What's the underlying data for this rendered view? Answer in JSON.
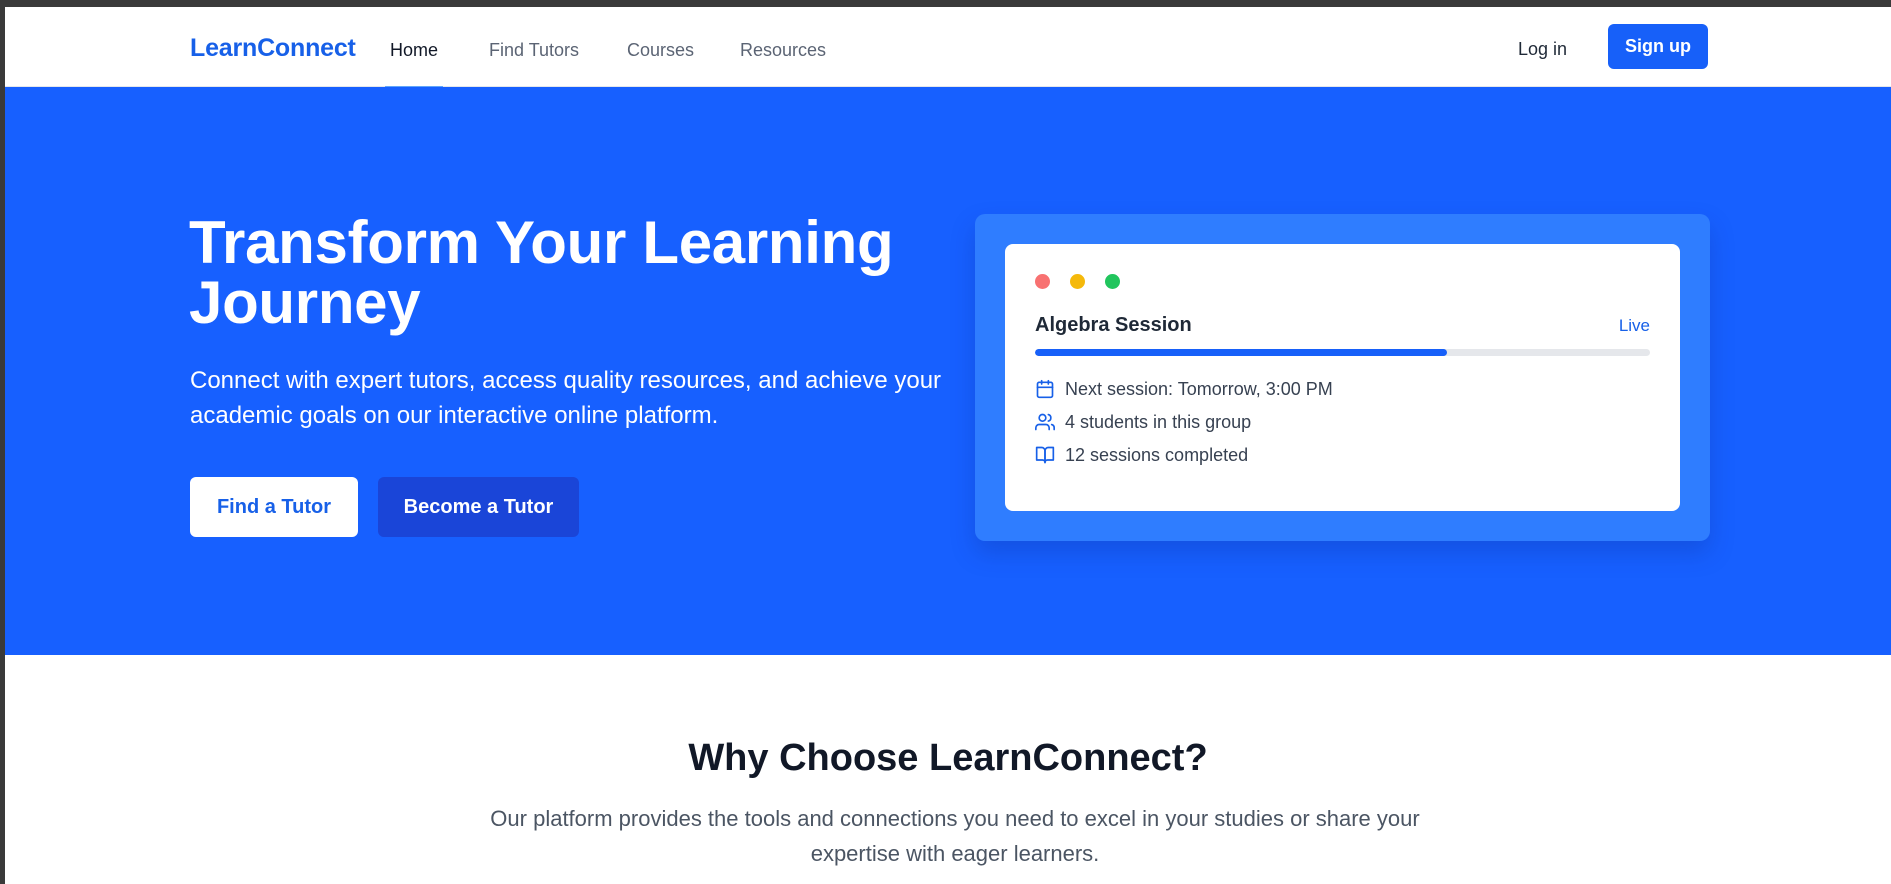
{
  "nav": {
    "brand": "LearnConnect",
    "links": [
      {
        "label": "Home",
        "active": true
      },
      {
        "label": "Find Tutors"
      },
      {
        "label": "Courses"
      },
      {
        "label": "Resources"
      }
    ],
    "login": "Log in",
    "signup": "Sign up"
  },
  "hero": {
    "title": "Transform Your Learning Journey",
    "subtitle": "Connect with expert tutors, access quality resources, and achieve your academic goals on our interactive online platform.",
    "primary_cta": "Find a Tutor",
    "secondary_cta": "Become a Tutor"
  },
  "session_card": {
    "title": "Algebra Session",
    "status": "Live",
    "progress_percent": 67,
    "items": [
      {
        "icon": "calendar-icon",
        "text": "Next session: Tomorrow, 3:00 PM"
      },
      {
        "icon": "users-icon",
        "text": "4 students in this group"
      },
      {
        "icon": "book-open-icon",
        "text": "12 sessions completed"
      }
    ]
  },
  "why": {
    "title": "Why Choose LearnConnect?",
    "subtitle": "Our platform provides the tools and connections you need to excel in your studies or share your expertise with eager learners."
  },
  "colors": {
    "brand": "#1760e8",
    "hero_bg": "#1760ff",
    "card_outer": "#2f7dff",
    "dot_red": "#f87171",
    "dot_yellow": "#f5b90b",
    "dot_green": "#21c55d"
  }
}
